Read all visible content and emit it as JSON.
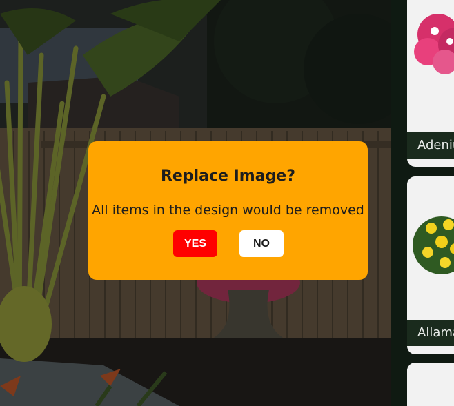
{
  "dialog": {
    "title": "Replace Image?",
    "message": "All items in the design would be removed",
    "yes_label": "YES",
    "no_label": "NO"
  },
  "plant_panel": {
    "items": [
      {
        "label": "Adenium"
      },
      {
        "label": "Allamanda"
      },
      {
        "label": ""
      }
    ]
  },
  "colors": {
    "dialog_background": "#ffa500",
    "yes_button": "#ff0000",
    "no_button": "#ffffff",
    "panel_background": "#0f1a12"
  }
}
